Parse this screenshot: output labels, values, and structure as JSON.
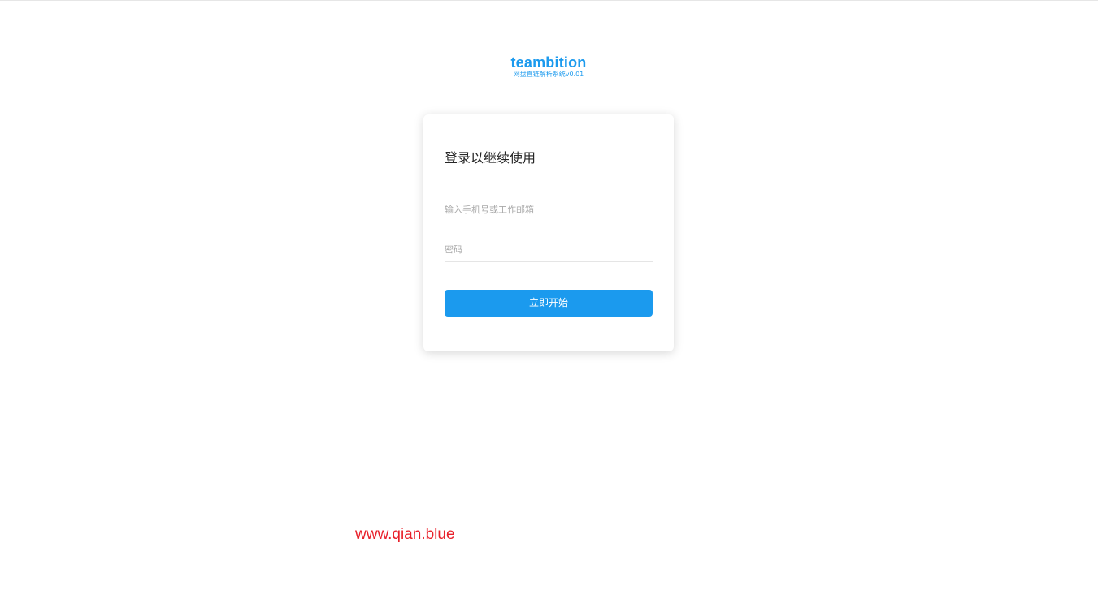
{
  "logo": {
    "name": "teambition",
    "subtitle": "网盘直链解析系统v0.01",
    "color": "#1b9aee"
  },
  "login": {
    "title": "登录以继续使用",
    "account_placeholder": "输入手机号或工作邮箱",
    "password_placeholder": "密码",
    "submit_label": "立即开始"
  },
  "watermark": {
    "text": "www.qian.blue",
    "color": "#e8202a"
  },
  "colors": {
    "accent": "#1b9aee",
    "background": "#ffffff"
  }
}
